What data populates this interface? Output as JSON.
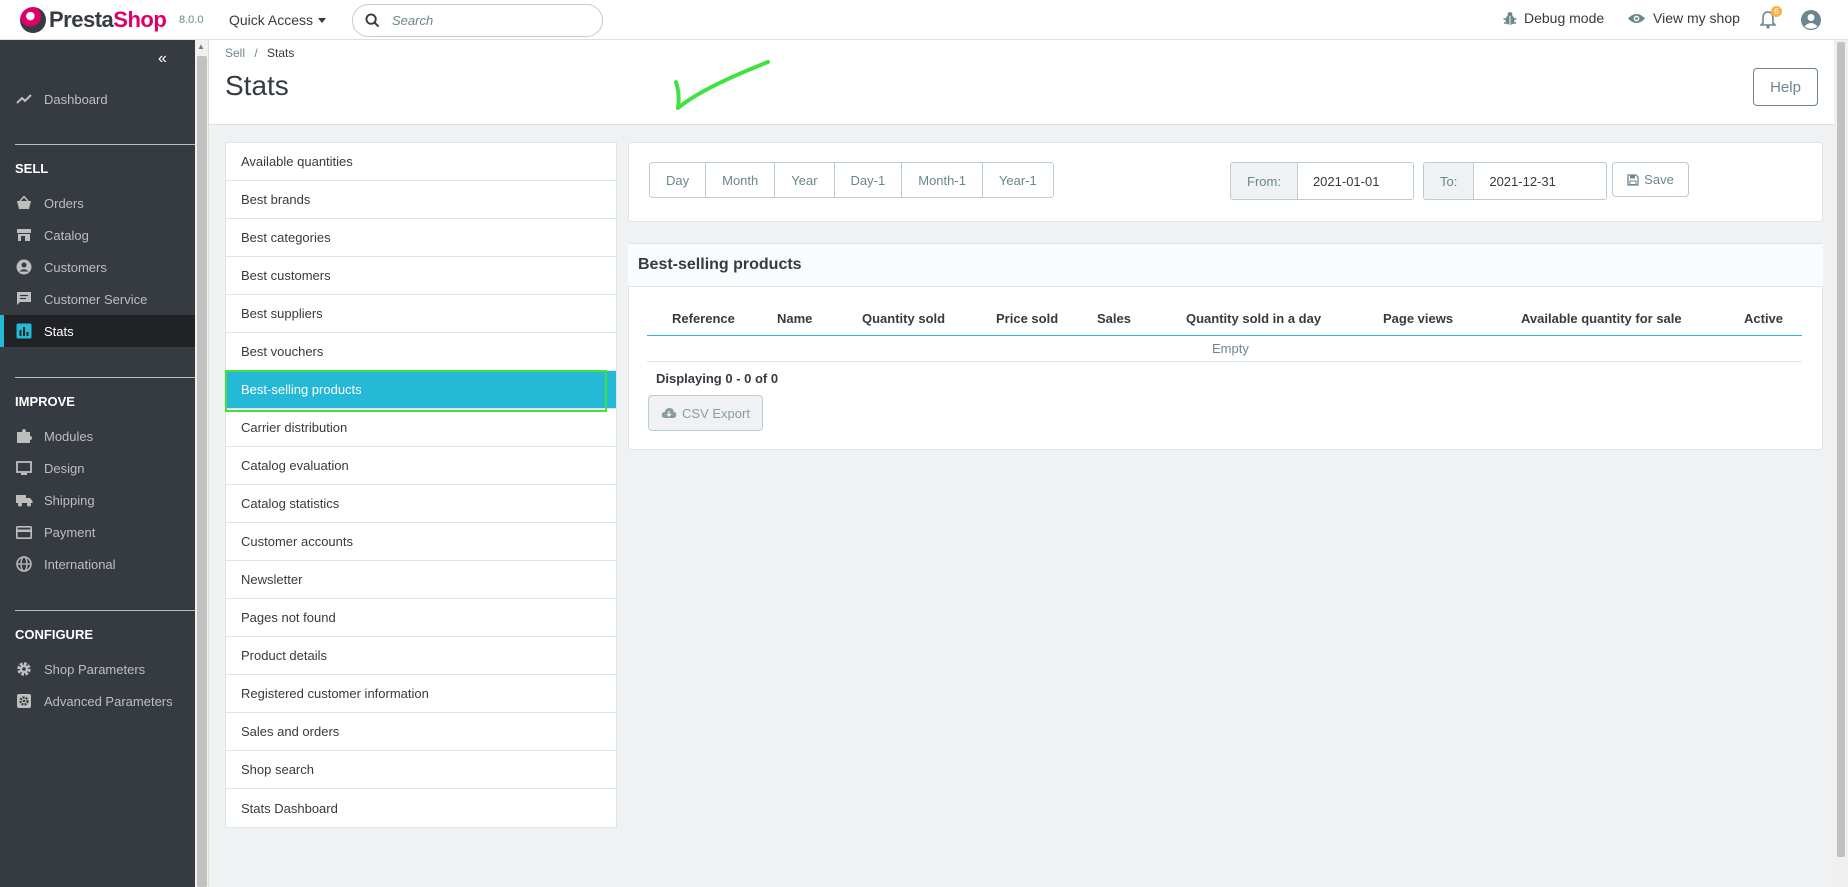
{
  "header": {
    "brand_first": "Presta",
    "brand_second": "Shop",
    "version": "8.0.0",
    "quick_access": "Quick Access",
    "search_placeholder": "Search",
    "debug_mode": "Debug mode",
    "view_my_shop": "View my shop",
    "notifications_count": "6"
  },
  "sidebar": {
    "dashboard": "Dashboard",
    "sections": [
      {
        "title": "SELL",
        "items": [
          "Orders",
          "Catalog",
          "Customers",
          "Customer Service",
          "Stats"
        ]
      },
      {
        "title": "IMPROVE",
        "items": [
          "Modules",
          "Design",
          "Shipping",
          "Payment",
          "International"
        ]
      },
      {
        "title": "CONFIGURE",
        "items": [
          "Shop Parameters",
          "Advanced Parameters"
        ]
      }
    ],
    "active_item": "Stats"
  },
  "breadcrumb": {
    "parent": "Sell",
    "separator": "/",
    "current": "Stats"
  },
  "page_title": "Stats",
  "help_button": "Help",
  "stats_modules": [
    "Available quantities",
    "Best brands",
    "Best categories",
    "Best customers",
    "Best suppliers",
    "Best vouchers",
    "Best-selling products",
    "Carrier distribution",
    "Catalog evaluation",
    "Catalog statistics",
    "Customer accounts",
    "Newsletter",
    "Pages not found",
    "Product details",
    "Registered customer information",
    "Sales and orders",
    "Shop search",
    "Stats Dashboard"
  ],
  "active_module": "Best-selling products",
  "period_buttons": [
    "Day",
    "Month",
    "Year",
    "Day-1",
    "Month-1",
    "Year-1"
  ],
  "date_range": {
    "from_label": "From:",
    "from_value": "2021-01-01",
    "to_label": "To:",
    "to_value": "2021-12-31",
    "save_label": "Save"
  },
  "report": {
    "title": "Best-selling products",
    "columns": [
      "Reference",
      "Name",
      "Quantity sold",
      "Price sold",
      "Sales",
      "Quantity sold in a day",
      "Page views",
      "Available quantity for sale",
      "Active"
    ],
    "empty_text": "Empty",
    "displaying": "Displaying 0 - 0 of 0",
    "csv_export": "CSV Export"
  },
  "colors": {
    "accent": "#25b9d7",
    "sidebar_bg": "#363a41",
    "brand_pink": "#df0067",
    "annotation_green": "#3fe23f"
  }
}
